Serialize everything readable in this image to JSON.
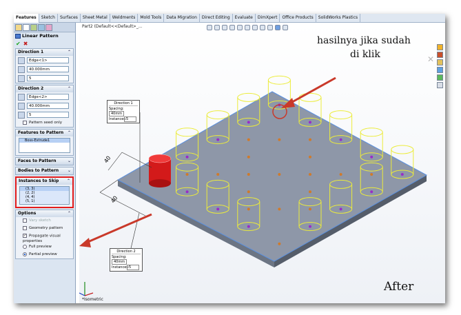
{
  "tabs": [
    "Features",
    "Sketch",
    "Surfaces",
    "Sheet Metal",
    "Weldments",
    "Mold Tools",
    "Data Migration",
    "Direct Editing",
    "Evaluate",
    "DimXpert",
    "Office Products",
    "SolidWorks Plastics"
  ],
  "pm": {
    "title": "Linear Pattern",
    "direction1": {
      "header": "Direction 1",
      "edge": "Edge<1>",
      "spacing": "40.000mm",
      "instances": "5"
    },
    "direction2": {
      "header": "Direction 2",
      "edge": "Edge<2>",
      "spacing": "40.000mm",
      "instances": "5",
      "seed_only": "Pattern seed only"
    },
    "features": {
      "header": "Features to Pattern",
      "item": "Boss-Extrude1"
    },
    "faces_header": "Faces to Pattern",
    "bodies_header": "Bodies to Pattern",
    "skip": {
      "header": "Instances to Skip",
      "items": [
        "(3, 3)",
        "(2, 2)",
        "(4, 4)",
        "(5, 1)"
      ]
    },
    "options": {
      "header": "Options",
      "vary_sketch": "Vary sketch",
      "geometry_pattern": "Geometry pattern",
      "propagate": "Propagate visual properties",
      "full_preview": "Full preview",
      "partial_preview": "Partial preview"
    }
  },
  "viewport": {
    "breadcrumb": "Part2  (Default<<Default>_...",
    "callout1": {
      "title": "Direction 1",
      "spacing_label": "Spacing:",
      "spacing": "40mm",
      "instances_label": "Instances:",
      "instances": "5"
    },
    "callout2": {
      "title": "Direction 2",
      "spacing_label": "Spacing:",
      "spacing": "40mm",
      "instances_label": "Instances:",
      "instances": "5"
    },
    "annotation_line1": "hasilnya jika sudah",
    "annotation_line2": "di klik",
    "after_label": "After",
    "view_label": "*Isometric",
    "dim_label_1": "40",
    "dim_label_2": "40"
  },
  "colors": {
    "plate_top": "#8e97a8",
    "plate_side": "#6c7584",
    "cylinder": "#ecec3a",
    "seed": "#e01414",
    "arrow": "#c9392a",
    "purple_dot": "#9a2cc7",
    "orange_dot": "#d07a2a"
  }
}
